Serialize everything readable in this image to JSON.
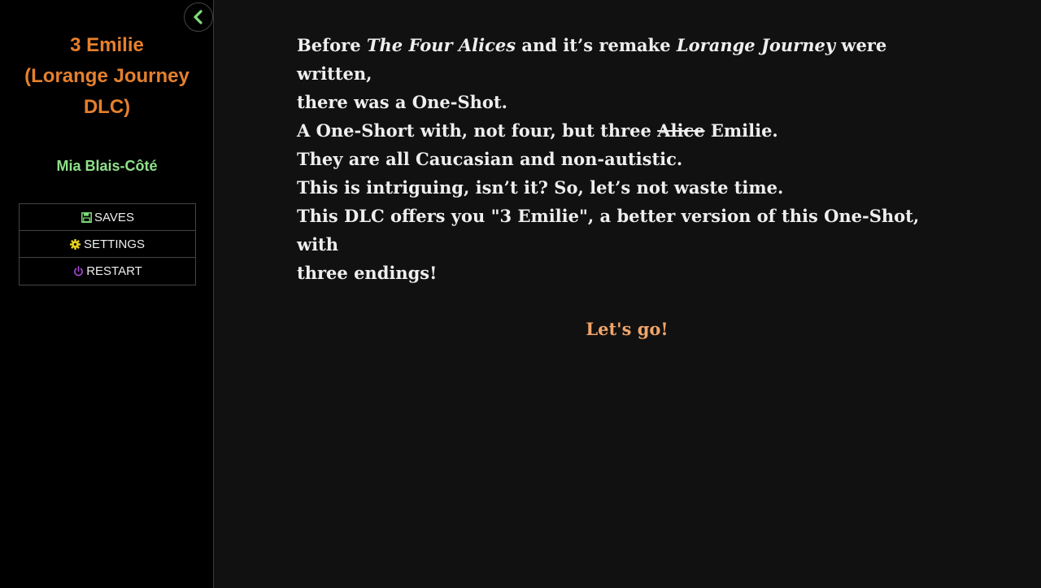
{
  "sidebar": {
    "title": "3 Emilie\n(Lorange Journey\nDLC)",
    "author": "Mia Blais-Côté",
    "menu": {
      "saves": "SAVES",
      "settings": "SETTINGS",
      "restart": "RESTART"
    }
  },
  "passage": {
    "line1": {
      "a": "Before ",
      "b_em": "The Four Alices",
      "c": " and it’s remake ",
      "d_em": "Lorange Journey",
      "e": " were written,"
    },
    "line2": "there was a One-Shot.",
    "line3": {
      "a": "A One-Short with, not four, but three ",
      "b_strike": "Alice",
      "c": " Emilie."
    },
    "line4": "They are all Caucasian and non-autistic.",
    "line5": "This is intriguing, isn’t it? So, let’s not waste time.",
    "line6": "This DLC offers you \"3 Emilie\", a better version of this One-Shot, with\nthree endings!",
    "link": "Let's go!"
  },
  "colors": {
    "title": "#e5802d",
    "author": "#8fe08a",
    "link": "#f0a46a",
    "toggle_chevron": "#7fdc7a",
    "save_icon": "#7fdc7a",
    "settings_icon": "#e8d21a",
    "restart_icon": "#a74ad6"
  }
}
